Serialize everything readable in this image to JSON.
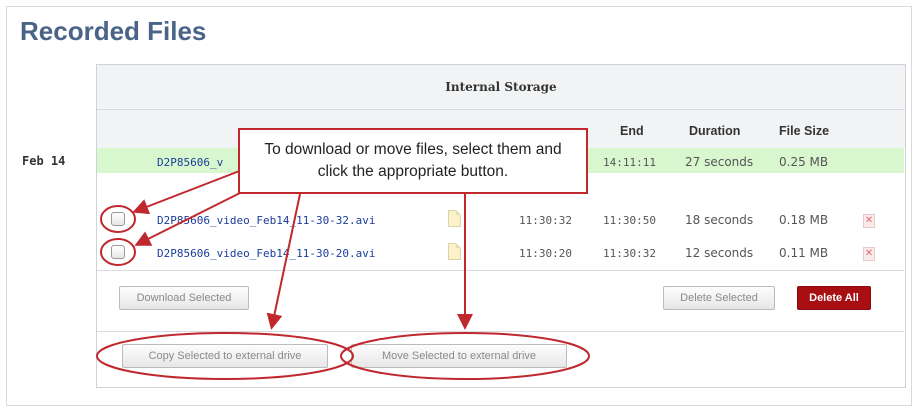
{
  "page": {
    "title": "Recorded Files"
  },
  "storage": {
    "title": "Internal Storage"
  },
  "columns": {
    "end": "End",
    "duration": "Duration",
    "file_size": "File Size"
  },
  "date_group": {
    "label": "Feb 14"
  },
  "highlighted_row": {
    "filename_partial": "D2P85606_v",
    "end": "14:11:11",
    "duration": "27 seconds",
    "size": "0.25 MB"
  },
  "files": [
    {
      "name": "D2P85606_video_Feb14_11-30-32.avi",
      "start": "11:30:32",
      "end": "11:30:50",
      "duration": "18 seconds",
      "size": "0.18 MB"
    },
    {
      "name": "D2P85606_video_Feb14_11-30-20.avi",
      "start": "11:30:20",
      "end": "11:30:32",
      "duration": "12 seconds",
      "size": "0.11 MB"
    }
  ],
  "buttons": {
    "download_selected": "Download Selected",
    "delete_selected": "Delete Selected",
    "delete_all": "Delete All",
    "copy_external": "Copy Selected to external drive",
    "move_external": "Move Selected to external drive"
  },
  "callout": {
    "text": "To download or move files, select them and click the appropriate button."
  },
  "colors": {
    "title": "#4a6489",
    "highlight_row": "#d9f7cf",
    "danger": "#a70f12",
    "annotation": "#c0282d",
    "link": "#1a3d9a"
  },
  "icons": {
    "notes": "note-icon",
    "delete": "delete-x-icon"
  }
}
